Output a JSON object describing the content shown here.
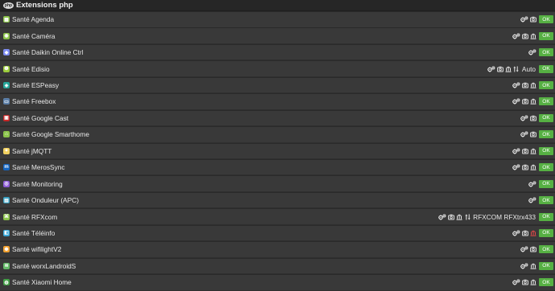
{
  "header": {
    "title": "Extensions php",
    "logo_text": "php"
  },
  "ok_label": "OK",
  "rows": [
    {
      "label": "Santé Agenda",
      "icon_color": "#8bc34a",
      "icon_glyph": "▦",
      "extra": "",
      "icons": [
        "cogs-icon",
        "camera-icon"
      ]
    },
    {
      "label": "Santé Caméra",
      "icon_color": "#8bc34a",
      "icon_glyph": "◉",
      "extra": "",
      "icons": [
        "cogs-icon",
        "camera-icon",
        "bank-icon"
      ]
    },
    {
      "label": "Santé Daikin Online Ctrl",
      "icon_color": "#7e8cf0",
      "icon_glyph": "◆",
      "extra": "",
      "icons": [
        "cogs-icon"
      ]
    },
    {
      "label": "Santé Edisio",
      "icon_color": "#9ccc3c",
      "icon_glyph": "❶",
      "extra": "Auto",
      "icons": [
        "cogs-icon",
        "camera-icon",
        "bank-icon",
        "sort-icon"
      ]
    },
    {
      "label": "Santé ESPeasy",
      "icon_color": "#26a69a",
      "icon_glyph": "◈",
      "extra": "",
      "icons": [
        "cogs-icon",
        "camera-icon",
        "bank-icon"
      ]
    },
    {
      "label": "Santé Freebox",
      "icon_color": "#5c7fa8",
      "icon_glyph": "▭",
      "extra": "",
      "icons": [
        "cogs-icon",
        "camera-icon",
        "bank-icon"
      ]
    },
    {
      "label": "Santé Google Cast",
      "icon_color": "#c62828",
      "icon_glyph": "▣",
      "extra": "",
      "icons": [
        "cogs-icon",
        "camera-icon"
      ]
    },
    {
      "label": "Santé Google Smarthome",
      "icon_color": "#8bc34a",
      "icon_glyph": "⌂",
      "extra": "",
      "icons": [
        "cogs-icon",
        "camera-icon"
      ]
    },
    {
      "label": "Santé jMQTT",
      "icon_color": "#f0d060",
      "icon_glyph": "✦",
      "extra": "",
      "icons": [
        "cogs-icon",
        "camera-icon",
        "bank-icon"
      ]
    },
    {
      "label": "Santé MerosSync",
      "icon_color": "#1565c0",
      "icon_glyph": "m",
      "extra": "",
      "icons": [
        "cogs-icon",
        "camera-icon",
        "bank-icon"
      ]
    },
    {
      "label": "Santé Monitoring",
      "icon_color": "#8e5cd6",
      "icon_glyph": "◎",
      "extra": "",
      "icons": [
        "cogs-icon"
      ]
    },
    {
      "label": "Santé Onduleur (APC)",
      "icon_color": "#3aa0c0",
      "icon_glyph": "▤",
      "extra": "",
      "icons": [
        "cogs-icon"
      ]
    },
    {
      "label": "Santé RFXcom",
      "icon_color": "#8bc34a",
      "icon_glyph": "⌘",
      "extra": "RFXCOM RFXtrx433",
      "icons": [
        "cogs-icon",
        "camera-icon",
        "bank-icon",
        "sort-icon"
      ]
    },
    {
      "label": "Santé Téléinfo",
      "icon_color": "#3aa8d8",
      "icon_glyph": "◧",
      "extra": "",
      "icons": [
        "cogs-icon",
        "camera-icon",
        "bank-icon-red"
      ]
    },
    {
      "label": "Santé wifilightV2",
      "icon_color": "#f0a030",
      "icon_glyph": "✺",
      "extra": "",
      "icons": [
        "cogs-icon",
        "camera-icon"
      ]
    },
    {
      "label": "Santé worxLandroidS",
      "icon_color": "#66bb6a",
      "icon_glyph": "≋",
      "extra": "",
      "icons": [
        "cogs-icon",
        "bank-icon"
      ]
    },
    {
      "label": "Santé Xiaomi Home",
      "icon_color": "#43a047",
      "icon_glyph": "◍",
      "extra": "",
      "icons": [
        "cogs-icon",
        "camera-icon",
        "bank-icon"
      ]
    }
  ]
}
